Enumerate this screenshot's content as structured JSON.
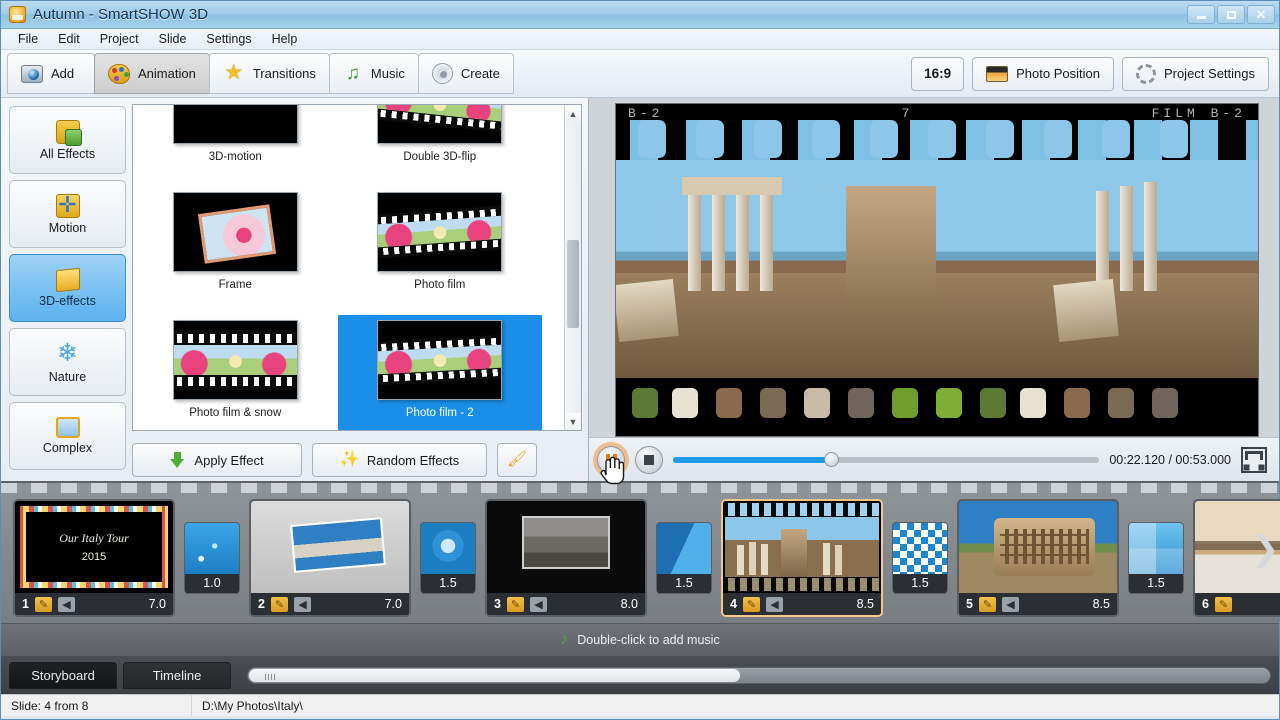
{
  "window": {
    "title": "Autumn - SmartSHOW 3D",
    "icon": "app-icon",
    "controls": {
      "minimize": "–",
      "maximize": "□",
      "close": "✕"
    }
  },
  "menu": {
    "items": [
      "File",
      "Edit",
      "Project",
      "Slide",
      "Settings",
      "Help"
    ]
  },
  "toolbar": {
    "tabs": [
      {
        "label": "Add",
        "icon": "camera-icon",
        "active": false
      },
      {
        "label": "Animation",
        "icon": "palette-icon",
        "active": true
      },
      {
        "label": "Transitions",
        "icon": "star-icon",
        "active": false
      },
      {
        "label": "Music",
        "icon": "music-note-icon",
        "active": false
      },
      {
        "label": "Create",
        "icon": "disc-icon",
        "active": false
      }
    ],
    "aspect_ratio": "16:9",
    "photo_position": "Photo Position",
    "project_settings": "Project Settings"
  },
  "categories": [
    {
      "label": "All Effects",
      "icon": "puzzle-icon",
      "active": false
    },
    {
      "label": "Motion",
      "icon": "move-arrows-icon",
      "active": false
    },
    {
      "label": "3D-effects",
      "icon": "cube-icon",
      "active": true
    },
    {
      "label": "Nature",
      "icon": "snowflake-icon",
      "active": false
    },
    {
      "label": "Complex",
      "icon": "layers-icon",
      "active": false
    }
  ],
  "effects": [
    {
      "label": "3D-motion",
      "selected": false,
      "art": "motion"
    },
    {
      "label": "Double 3D-flip",
      "selected": false,
      "art": "dark"
    },
    {
      "label": "Frame",
      "selected": false,
      "art": "frame"
    },
    {
      "label": "Photo film",
      "selected": false,
      "art": "film"
    },
    {
      "label": "Photo film & snow",
      "selected": false,
      "art": "film"
    },
    {
      "label": "Photo film - 2",
      "selected": true,
      "art": "film"
    },
    {
      "label": "",
      "selected": false,
      "art": "film"
    },
    {
      "label": "",
      "selected": false,
      "art": "dark"
    }
  ],
  "effect_actions": {
    "apply": "Apply Effect",
    "random": "Random Effects",
    "brush_icon": "paintbrush-icon"
  },
  "preview": {
    "film_label_left": "B-2",
    "film_label_mid": "7",
    "film_label_right": "FILM  B-2"
  },
  "playback": {
    "pause_icon": "pause-icon",
    "stop_icon": "stop-icon",
    "current_time": "00:22.120",
    "total_time": "00:53.000",
    "time_display": "00:22.120 / 00:53.000",
    "progress_percent": 37,
    "fullscreen_icon": "fullscreen-icon"
  },
  "storyboard": {
    "slides": [
      {
        "number": "1",
        "duration": "7.0",
        "title_line1": "Our Italy Tour",
        "title_line2": "2015",
        "kind": "title",
        "selected": false
      },
      {
        "number": "2",
        "duration": "7.0",
        "kind": "photo-vatican",
        "selected": false
      },
      {
        "number": "3",
        "duration": "8.0",
        "kind": "photo-frame",
        "selected": false
      },
      {
        "number": "4",
        "duration": "8.5",
        "kind": "photo-forum-film",
        "selected": true
      },
      {
        "number": "5",
        "duration": "8.5",
        "kind": "photo-colosseum",
        "selected": false
      },
      {
        "number": "6",
        "duration": "",
        "kind": "photo-bridge",
        "selected": false
      }
    ],
    "transitions": [
      {
        "duration": "1.0",
        "style": "stars"
      },
      {
        "duration": "1.5",
        "style": "swirl"
      },
      {
        "duration": "1.5",
        "style": "diagonal"
      },
      {
        "duration": "1.5",
        "style": "checker"
      },
      {
        "duration": "1.5",
        "style": "quad"
      }
    ],
    "next_arrow_icon": "chevron-right-icon",
    "edit_icon": "pencil-icon",
    "sound_icon": "speaker-icon"
  },
  "music_track": {
    "label": "Double-click to add music",
    "icon": "music-note-icon"
  },
  "view_tabs": [
    {
      "label": "Storyboard",
      "active": true
    },
    {
      "label": "Timeline",
      "active": false
    }
  ],
  "statusbar": {
    "slide_info": "Slide: 4 from 8",
    "path": "D:\\My Photos\\Italy\\"
  },
  "colors": {
    "accent_blue": "#1a8fe8",
    "selection_orange": "#f3c98b",
    "titlebar_blue": "#9ecbe9",
    "progress_blue": "#1f9ae8"
  }
}
